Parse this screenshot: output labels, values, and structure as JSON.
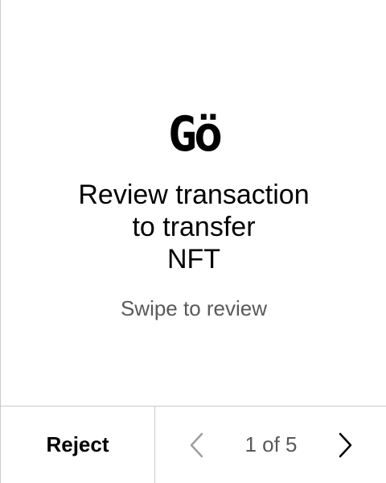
{
  "logo": {
    "text": "Gö",
    "icon": "ledger-go-logo"
  },
  "title_lines": [
    "Review transaction",
    "to transfer",
    "NFT"
  ],
  "subtitle": "Swipe to review",
  "footer": {
    "reject_label": "Reject",
    "page_indicator": "1 of 5",
    "prev_icon": "chevron-left-icon",
    "next_icon": "chevron-right-icon"
  },
  "colors": {
    "background": "#ffffff",
    "text": "#000000",
    "muted": "#595959",
    "disabled": "#9e9e9e",
    "divider": "#c9c9c9"
  }
}
